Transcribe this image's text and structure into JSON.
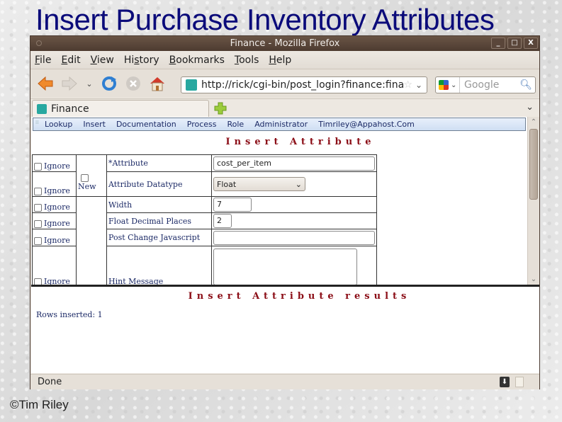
{
  "slide": {
    "title": "Insert Purchase Inventory Attributes",
    "copyright": "©Tim Riley"
  },
  "window": {
    "title": "Finance - Mozilla Firefox",
    "controls": {
      "minimize": "_",
      "maximize": "□",
      "close": "X"
    }
  },
  "menubar": {
    "items": [
      {
        "label": "File",
        "accel": "F"
      },
      {
        "label": "Edit",
        "accel": "E"
      },
      {
        "label": "View",
        "accel": "V"
      },
      {
        "label": "History",
        "accel": "s"
      },
      {
        "label": "Bookmarks",
        "accel": "B"
      },
      {
        "label": "Tools",
        "accel": "T"
      },
      {
        "label": "Help",
        "accel": "H"
      }
    ]
  },
  "navbar": {
    "url": "http://rick/cgi-bin/post_login?finance:financ",
    "search_placeholder": "Google",
    "icons": [
      "back-icon",
      "forward-icon",
      "history-dropdown-icon",
      "reload-icon",
      "stop-icon",
      "home-icon"
    ]
  },
  "tabs": [
    {
      "label": "Finance"
    }
  ],
  "app_menu": {
    "items": [
      "Lookup",
      "Insert",
      "Documentation",
      "Process",
      "Role",
      "Administrator",
      "Timriley@Appahost.Com"
    ]
  },
  "form": {
    "title": "Insert Attribute",
    "ignore_label": "Ignore",
    "new_label": "New",
    "rows": [
      {
        "label": "*Attribute",
        "type": "text",
        "value": "cost_per_item"
      },
      {
        "label": "Attribute Datatype",
        "type": "select",
        "value": "Float"
      },
      {
        "label": "Width",
        "type": "text",
        "value": "7"
      },
      {
        "label": "Float Decimal Places",
        "type": "text",
        "value": "2"
      },
      {
        "label": "Post Change Javascript",
        "type": "text",
        "value": ""
      },
      {
        "label": "Hint Message",
        "type": "textarea",
        "value": ""
      }
    ]
  },
  "results": {
    "title": "Insert Attribute results",
    "rows_inserted": "Rows inserted: 1"
  },
  "statusbar": {
    "text": "Done"
  }
}
